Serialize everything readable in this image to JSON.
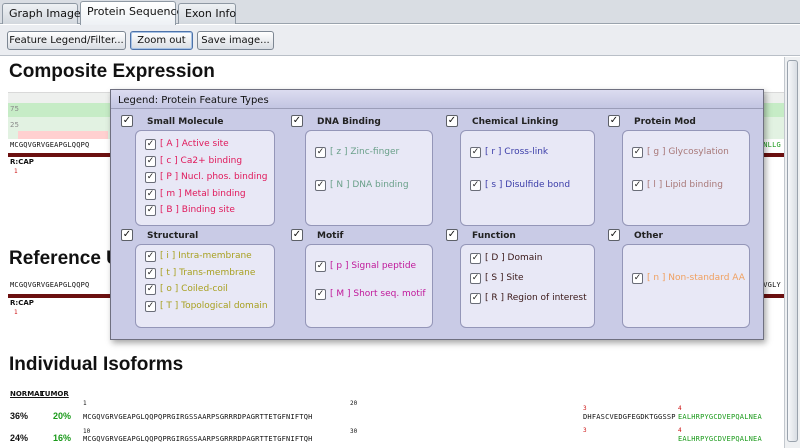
{
  "tabs": [
    {
      "label": "Graph Image"
    },
    {
      "label": "Protein Sequence"
    },
    {
      "label": "Exon Info"
    }
  ],
  "toolbar": {
    "legend_filter": "Feature Legend/Filter...",
    "zoom_out": "Zoom out",
    "save_image": "Save image..."
  },
  "sections": {
    "composite": "Composite Expression",
    "reference": "Reference U",
    "isoforms": "Individual Isoforms"
  },
  "composite": {
    "tick_75": "75",
    "tick_25": "25",
    "seq_left": "MCGQVGRVGEAPGLQQPQ",
    "seq_right": "SKENLLG",
    "track_label": "R:CAP",
    "marker": "1"
  },
  "reference": {
    "seq_left": "MCGQVGRVGEAPGLQQPQ",
    "seq_right": "KLRVGLY",
    "track_label": "R:CAP",
    "marker": "1"
  },
  "isoforms": {
    "columns": [
      "NORMAL",
      "TUMOR"
    ],
    "tick_1": "1",
    "tick_10": "10",
    "tick_20": "20",
    "tick_30": "30",
    "rows": [
      {
        "normal": "36%",
        "tumor": "20%",
        "seq": "MCGQVGRVGEAPGLQQPQPRGIRGSSAARPSGRRRDPAGRTTETGFNIFTQH",
        "mid_marker": "3",
        "mid_seq": "DHFASCVEDGFEGDKTGGSSP",
        "end_marker": "4",
        "end_seq": "EALHRPYGCDVEPQALNEA"
      },
      {
        "normal": "24%",
        "tumor": "16%",
        "seq": "MCGQVGRVGEAPGLQQPQPRGIRGSSAARPSGRRRDPAGRTTETGFNIFTQH",
        "mid_marker": "3",
        "end_marker": "4",
        "end_seq": "EALHRPYGCDVEPQALNEA"
      }
    ]
  },
  "legend": {
    "title": "Legend: Protein Feature Types",
    "groups": [
      {
        "title": "Small Molecule",
        "items": [
          {
            "label": "[ A ] Active site",
            "color": "#e0185a"
          },
          {
            "label": "[ c ] Ca2+ binding",
            "color": "#e0185a"
          },
          {
            "label": "[ P ] Nucl. phos. binding",
            "color": "#e0185a"
          },
          {
            "label": "[ m ] Metal binding",
            "color": "#e0185a"
          },
          {
            "label": "[ B ] Binding site",
            "color": "#e0185a"
          }
        ]
      },
      {
        "title": "DNA Binding",
        "items": [
          {
            "label": "[ z ] Zinc-finger",
            "color": "#6aa08a"
          },
          {
            "label": "[ N ] DNA binding",
            "color": "#6aa08a"
          }
        ]
      },
      {
        "title": "Chemical Linking",
        "items": [
          {
            "label": "[ r ] Cross-link",
            "color": "#3a3ca8"
          },
          {
            "label": "[ s ] Disulfide bond",
            "color": "#3a3ca8"
          }
        ]
      },
      {
        "title": "Protein Mod",
        "items": [
          {
            "label": "[ g ] Glycosylation",
            "color": "#a87878"
          },
          {
            "label": "[ l ] Lipid binding",
            "color": "#a87878"
          }
        ]
      },
      {
        "title": "Structural",
        "items": [
          {
            "label": "[ i ] Intra-membrane",
            "color": "#a8a020"
          },
          {
            "label": "[ t ] Trans-membrane",
            "color": "#a8a020"
          },
          {
            "label": "[ o ] Coiled-coil",
            "color": "#a8a020"
          },
          {
            "label": "[ T ] Topological domain",
            "color": "#a8a020"
          }
        ]
      },
      {
        "title": "Motif",
        "items": [
          {
            "label": "[ p ] Signal peptide",
            "color": "#c0189a"
          },
          {
            "label": "[ M ] Short seq. motif",
            "color": "#c0189a"
          }
        ]
      },
      {
        "title": "Function",
        "items": [
          {
            "label": "[ D ] Domain",
            "color": "#3a1818"
          },
          {
            "label": "[ S ] Site",
            "color": "#3a1818"
          },
          {
            "label": "[ R ] Region of interest",
            "color": "#3a1818"
          }
        ]
      },
      {
        "title": "Other",
        "items": [
          {
            "label": "[ n ] Non-standard AA",
            "color": "#f0a060"
          }
        ]
      }
    ]
  }
}
